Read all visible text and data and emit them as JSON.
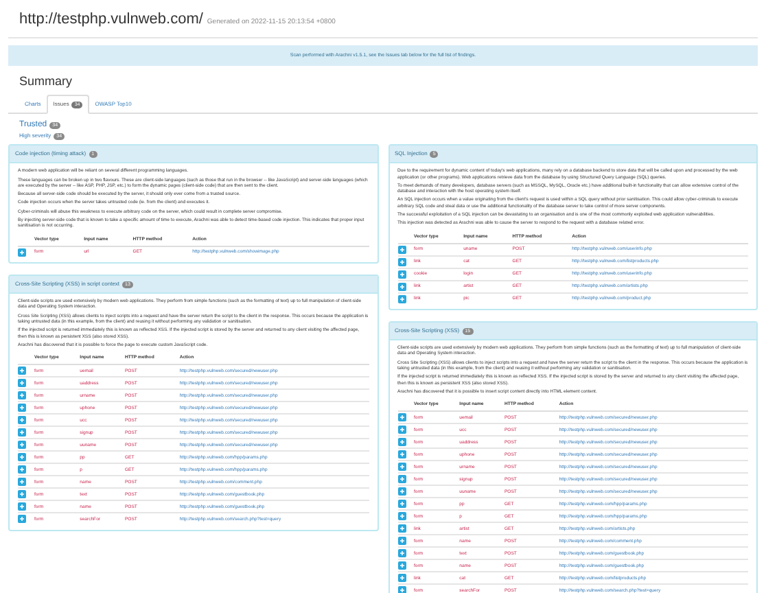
{
  "header": {
    "title": "http://testphp.vulnweb.com/",
    "generated": "Generated on 2022-11-15 20:13:54 +0800"
  },
  "banner": "Scan performed with Arachni v1.5.1, see the Issues tab below for the full list of findings.",
  "summary_title": "Summary",
  "tabs": [
    {
      "label": "Charts",
      "selected": false
    },
    {
      "label": "Issues",
      "badge": "34",
      "selected": true
    },
    {
      "label": "OWASP Top10",
      "selected": false
    }
  ],
  "trust": {
    "label": "Trusted",
    "count": "34"
  },
  "severity": {
    "label": "High severity",
    "count": "34"
  },
  "panels": [
    {
      "title": "Code injection (timing attack)",
      "count": "1",
      "columns": [
        "Vector type",
        "Input name",
        "HTTP method",
        "Action"
      ],
      "paragraphs": [
        "A modern web application will be reliant on several different programming languages.",
        "These languages can be broken up in two flavours. These are client-side languages (such as those that run in the browser -- like JavaScript) and server-side languages (which are executed by the server -- like ASP, PHP, JSP, etc.) to form the dynamic pages (client-side code) that are then sent to the client.",
        "Because all server-side code should be executed by the server, it should only ever come from a trusted source.",
        "Code injection occurs when the server takes untrusted code (ie. from the client) and executes it.",
        "Cyber-criminals will abuse this weakness to execute arbitrary code on the server, which could result in complete server compromise.",
        "By injecting server-side code that is known to take a specific amount of time to execute, Arachni was able to detect time-based code injection. This indicates that proper input sanitisation is not occurring."
      ],
      "rows": [
        {
          "vector": "form",
          "input": "url",
          "method": "GET",
          "action": "http://testphp.vulnweb.com/showimage.php"
        }
      ]
    },
    {
      "title": "SQL Injection",
      "count": "5",
      "columns": [
        "Vector type",
        "Input name",
        "HTTP method",
        "Action"
      ],
      "paragraphs": [
        "Due to the requirement for dynamic content of today's web applications, many rely on a database backend to store data that will be called upon and processed by the web application (or other programs). Web applications retrieve data from the database by using Structured Query Language (SQL) queries.",
        "To meet demands of many developers, database servers (such as MSSQL, MySQL, Oracle etc.) have additional built-in functionality that can allow extensive control of the database and interaction with the host operating system itself.",
        "An SQL injection occurs when a value originating from the client's request is used within a SQL query without prior sanitisation. This could allow cyber-criminals to execute arbitrary SQL code and steal data or use the additional functionality of the database server to take control of more server components.",
        "The successful exploitation of a SQL injection can be devastating to an organisation and is one of the most commonly exploited web application vulnerabilities.",
        "This injection was detected as Arachni was able to cause the server to respond to the request with a database related error."
      ],
      "rows": [
        {
          "vector": "form",
          "input": "uname",
          "method": "POST",
          "action": "http://testphp.vulnweb.com/userinfo.php"
        },
        {
          "vector": "link",
          "input": "cat",
          "method": "GET",
          "action": "http://testphp.vulnweb.com/listproducts.php"
        },
        {
          "vector": "cookie",
          "input": "login",
          "method": "GET",
          "action": "http://testphp.vulnweb.com/userinfo.php"
        },
        {
          "vector": "link",
          "input": "artist",
          "method": "GET",
          "action": "http://testphp.vulnweb.com/artists.php"
        },
        {
          "vector": "link",
          "input": "pic",
          "method": "GET",
          "action": "http://testphp.vulnweb.com/product.php"
        }
      ]
    },
    {
      "title": "Cross-Site Scripting (XSS) in script context",
      "count": "13",
      "columns": [
        "Vector type",
        "Input name",
        "HTTP method",
        "Action"
      ],
      "paragraphs": [
        "Client-side scripts are used extensively by modern web applications. They perform from simple functions (such as the formatting of text) up to full manipulation of client-side data and Operating System interaction.",
        "Cross Site Scripting (XSS) allows clients to inject scripts into a request and have the server return the script to the client in the response. This occurs because the application is taking untrusted data (in this example, from the client) and reusing it without performing any validation or sanitisation.",
        "If the injected script is returned immediately this is known as reflected XSS. If the injected script is stored by the server and returned to any client visiting the affected page, then this is known as persistent XSS (also stored XSS).",
        "Arachni has discovered that it is possible to force the page to execute custom JavaScript code."
      ],
      "rows": [
        {
          "vector": "form",
          "input": "uemail",
          "method": "POST",
          "action": "http://testphp.vulnweb.com/secured/newuser.php"
        },
        {
          "vector": "form",
          "input": "uaddress",
          "method": "POST",
          "action": "http://testphp.vulnweb.com/secured/newuser.php"
        },
        {
          "vector": "form",
          "input": "urname",
          "method": "POST",
          "action": "http://testphp.vulnweb.com/secured/newuser.php"
        },
        {
          "vector": "form",
          "input": "uphone",
          "method": "POST",
          "action": "http://testphp.vulnweb.com/secured/newuser.php"
        },
        {
          "vector": "form",
          "input": "ucc",
          "method": "POST",
          "action": "http://testphp.vulnweb.com/secured/newuser.php"
        },
        {
          "vector": "form",
          "input": "signup",
          "method": "POST",
          "action": "http://testphp.vulnweb.com/secured/newuser.php"
        },
        {
          "vector": "form",
          "input": "uuname",
          "method": "POST",
          "action": "http://testphp.vulnweb.com/secured/newuser.php"
        },
        {
          "vector": "form",
          "input": "pp",
          "method": "GET",
          "action": "http://testphp.vulnweb.com/hpp/params.php"
        },
        {
          "vector": "form",
          "input": "p",
          "method": "GET",
          "action": "http://testphp.vulnweb.com/hpp/params.php"
        },
        {
          "vector": "form",
          "input": "name",
          "method": "POST",
          "action": "http://testphp.vulnweb.com/comment.php"
        },
        {
          "vector": "form",
          "input": "text",
          "method": "POST",
          "action": "http://testphp.vulnweb.com/guestbook.php"
        },
        {
          "vector": "form",
          "input": "name",
          "method": "POST",
          "action": "http://testphp.vulnweb.com/guestbook.php"
        },
        {
          "vector": "form",
          "input": "searchFor",
          "method": "POST",
          "action": "http://testphp.vulnweb.com/search.php?test=query"
        }
      ]
    },
    {
      "title": "Cross-Site Scripting (XSS)",
      "count": "15",
      "columns": [
        "Vector type",
        "Input name",
        "HTTP method",
        "Action"
      ],
      "paragraphs": [
        "Client-side scripts are used extensively by modern web applications. They perform from simple functions (such as the formatting of text) up to full manipulation of client-side data and Operating System interaction.",
        "Cross Site Scripting (XSS) allows clients to inject scripts into a request and have the server return the script to the client in the response. This occurs because the application is taking untrusted data (in this example, from the client) and reusing it without performing any validation or sanitisation.",
        "If the injected script is returned immediately this is known as reflected XSS. If the injected script is stored by the server and returned to any client visiting the affected page, then this is known as persistent XSS (also stored XSS).",
        "Arachni has discovered that it is possible to insert script content directly into HTML element content."
      ],
      "rows": [
        {
          "vector": "form",
          "input": "uemail",
          "method": "POST",
          "action": "http://testphp.vulnweb.com/secured/newuser.php"
        },
        {
          "vector": "form",
          "input": "ucc",
          "method": "POST",
          "action": "http://testphp.vulnweb.com/secured/newuser.php"
        },
        {
          "vector": "form",
          "input": "uaddress",
          "method": "POST",
          "action": "http://testphp.vulnweb.com/secured/newuser.php"
        },
        {
          "vector": "form",
          "input": "uphone",
          "method": "POST",
          "action": "http://testphp.vulnweb.com/secured/newuser.php"
        },
        {
          "vector": "form",
          "input": "urname",
          "method": "POST",
          "action": "http://testphp.vulnweb.com/secured/newuser.php"
        },
        {
          "vector": "form",
          "input": "signup",
          "method": "POST",
          "action": "http://testphp.vulnweb.com/secured/newuser.php"
        },
        {
          "vector": "form",
          "input": "uuname",
          "method": "POST",
          "action": "http://testphp.vulnweb.com/secured/newuser.php"
        },
        {
          "vector": "form",
          "input": "pp",
          "method": "GET",
          "action": "http://testphp.vulnweb.com/hpp/params.php"
        },
        {
          "vector": "form",
          "input": "p",
          "method": "GET",
          "action": "http://testphp.vulnweb.com/hpp/params.php"
        },
        {
          "vector": "link",
          "input": "artist",
          "method": "GET",
          "action": "http://testphp.vulnweb.com/artists.php"
        },
        {
          "vector": "form",
          "input": "name",
          "method": "POST",
          "action": "http://testphp.vulnweb.com/comment.php"
        },
        {
          "vector": "form",
          "input": "text",
          "method": "POST",
          "action": "http://testphp.vulnweb.com/guestbook.php"
        },
        {
          "vector": "form",
          "input": "name",
          "method": "POST",
          "action": "http://testphp.vulnweb.com/guestbook.php"
        },
        {
          "vector": "link",
          "input": "cat",
          "method": "GET",
          "action": "http://testphp.vulnweb.com/listproducts.php"
        },
        {
          "vector": "form",
          "input": "searchFor",
          "method": "POST",
          "action": "http://testphp.vulnweb.com/search.php?test=query"
        }
      ]
    }
  ]
}
